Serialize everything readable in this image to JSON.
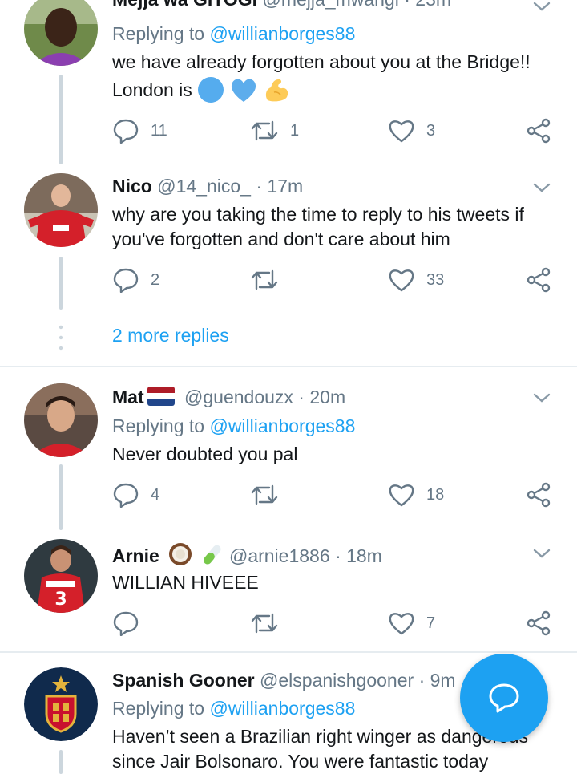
{
  "tweets": [
    {
      "name": "Mejja wa GITOGI",
      "handle": "@mejja_mwangi",
      "time": "23m",
      "replying_prefix": "Replying to",
      "replying_to": "@willianborges88",
      "text": "we have already forgotten about you at the Bridge!!",
      "text_line2": "London is",
      "emojis": [
        "blue-circle-icon",
        "blue-heart-icon",
        "flexed-biceps-icon"
      ],
      "reply_count": "11",
      "retweet_count": "1",
      "like_count": "3"
    },
    {
      "name": "Nico",
      "handle": "@14_nico_",
      "time": "17m",
      "text": "why are you taking the time to reply to his tweets if you've forgotten and don't care about him",
      "reply_count": "2",
      "retweet_count": "",
      "like_count": "33"
    },
    {
      "name": "Mat",
      "handle": "@guendouzx",
      "time": "20m",
      "replying_prefix": "Replying to",
      "replying_to": "@willianborges88",
      "text": "Never doubted you pal",
      "reply_count": "4",
      "retweet_count": "",
      "like_count": "18"
    },
    {
      "name": "Arnie",
      "handle": "@arnie1886",
      "time": "18m",
      "text": "WILLIAN HIVEEE",
      "reply_count": "",
      "retweet_count": "",
      "like_count": "7"
    },
    {
      "name": "Spanish Gooner",
      "handle": "@elspanishgooner",
      "time": "9m",
      "replying_prefix": "Replying to",
      "replying_to": "@willianborges88",
      "text_line1": "Haven’t seen a Brazilian right winger as dangerous",
      "text_line2": "since Jair Bolsonaro. You were fantastic today"
    }
  ],
  "more_replies": "2 more replies",
  "separator": "·",
  "colors": {
    "accent": "#1da1f2",
    "muted": "#657786",
    "divider": "#e6ecf0"
  },
  "fab_icon": "compose-reply-icon"
}
